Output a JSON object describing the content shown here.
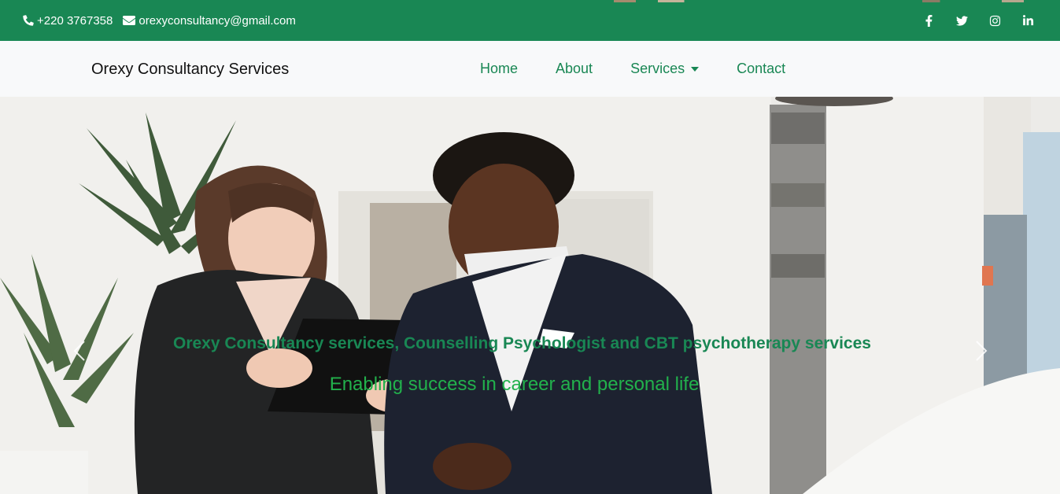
{
  "topbar": {
    "phone": "+220 3767358",
    "email": "orexyconsultancy@gmail.com",
    "phone_icon": "phone-icon",
    "email_icon": "envelope-icon",
    "social": [
      "facebook-icon",
      "twitter-icon",
      "instagram-icon",
      "linkedin-icon"
    ],
    "bg_color": "#198754"
  },
  "navbar": {
    "brand": "Orexy Consultancy Services",
    "links": [
      "Home",
      "About",
      "Services",
      "Contact"
    ],
    "link_color": "#198754"
  },
  "hero": {
    "title": "Orexy Consultancy services, Counselling Psychologist and CBT psychotherapy services",
    "subtitle": "Enabling success in career and personal life",
    "prev_icon": "chevron-left-icon",
    "next_icon": "chevron-right-icon"
  }
}
